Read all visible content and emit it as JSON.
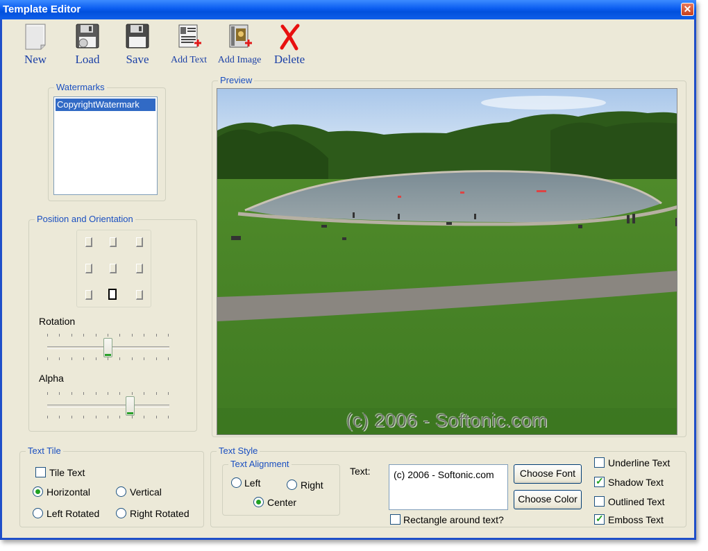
{
  "window": {
    "title": "Template Editor",
    "close_glyph": "✕"
  },
  "toolbar": {
    "new": "New",
    "load": "Load",
    "save": "Save",
    "add_text": "Add Text",
    "add_image": "Add Image",
    "delete": "Delete"
  },
  "watermarks": {
    "title": "Watermarks",
    "items": [
      "CopyrightWatermark"
    ]
  },
  "position": {
    "title": "Position and Orientation",
    "selected": "bottom-center"
  },
  "rotation": {
    "label": "Rotation",
    "value_fraction": 0.5
  },
  "alpha": {
    "label": "Alpha",
    "value_fraction": 0.7
  },
  "preview": {
    "title": "Preview",
    "watermark_text": "(c) 2006 - Softonic.com"
  },
  "text_tile": {
    "title": "Text Tile",
    "tile_text": {
      "label": "Tile Text",
      "checked": false
    },
    "horizontal": "Horizontal",
    "vertical": "Vertical",
    "left_rotated": "Left Rotated",
    "right_rotated": "Right Rotated",
    "selected": "Horizontal"
  },
  "text_style": {
    "title": "Text Style",
    "alignment_title": "Text Alignment",
    "left": "Left",
    "right": "Right",
    "center": "Center",
    "selected_alignment": "Center",
    "text_label": "Text:",
    "text_value": "(c) 2006 - Softonic.com",
    "choose_font": "Choose Font",
    "choose_color": "Choose Color",
    "rectangle": {
      "label": "Rectangle around text?",
      "checked": false
    },
    "underline": {
      "label": "Underline Text",
      "checked": false
    },
    "shadow": {
      "label": "Shadow Text",
      "checked": true
    },
    "outlined": {
      "label": "Outlined Text",
      "checked": false
    },
    "emboss": {
      "label": "Emboss Text",
      "checked": true
    }
  },
  "colors": {
    "title_bar": "#0a5cf0",
    "group_title": "#1a4fc0",
    "accent_check": "#21a121"
  }
}
